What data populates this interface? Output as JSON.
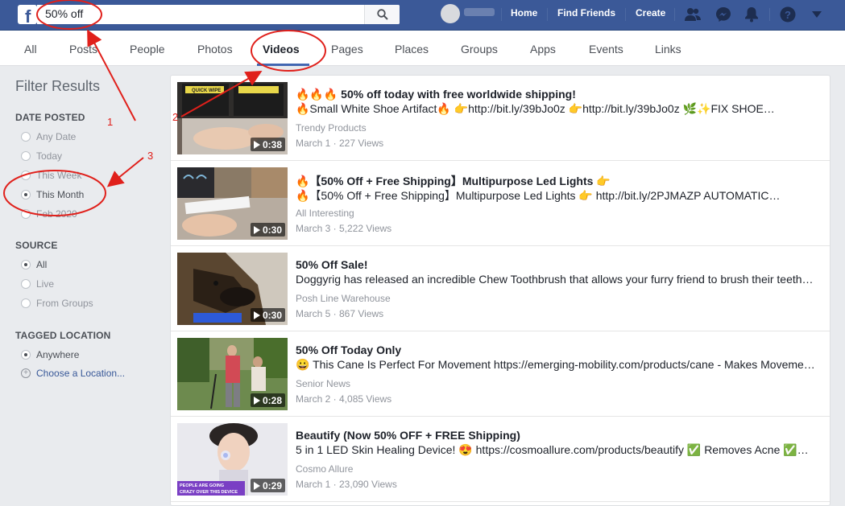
{
  "header": {
    "logo": "f",
    "search_value": "50% off",
    "nav": [
      "Home",
      "Find Friends",
      "Create"
    ]
  },
  "tabs": [
    "All",
    "Posts",
    "People",
    "Photos",
    "Videos",
    "Pages",
    "Places",
    "Groups",
    "Apps",
    "Events",
    "Links"
  ],
  "sidebar": {
    "title": "Filter Results",
    "date_posted": {
      "heading": "DATE POSTED",
      "options": [
        "Any Date",
        "Today",
        "This Week",
        "This Month",
        "Feb 2020"
      ],
      "selected": "This Month"
    },
    "source": {
      "heading": "SOURCE",
      "options": [
        "All",
        "Live",
        "From Groups"
      ],
      "selected": "All"
    },
    "tagged_location": {
      "heading": "TAGGED LOCATION",
      "options": [
        "Anywhere"
      ],
      "selected": "Anywhere",
      "choose": "Choose a Location..."
    }
  },
  "results": [
    {
      "title": "🔥🔥🔥 50% off today with free worldwide shipping!",
      "desc": "🔥Small White Shoe Artifact🔥 👉http://bit.ly/39bJo0z 👉http://bit.ly/39bJo0z 🌿✨FIX SHOE…",
      "page": "Trendy Products",
      "meta": "March 1 · 227 Views",
      "duration": "0:38",
      "thumb_text": "QUICK WIPE"
    },
    {
      "title": "🔥【50% Off + Free Shipping】Multipurpose Led Lights 👉",
      "desc": "🔥【50% Off + Free Shipping】Multipurpose Led Lights 👉 http://bit.ly/2PJMAZP AUTOMATIC…",
      "page": "All Interesting",
      "meta": "March 3 · 5,222 Views",
      "duration": "0:30",
      "thumb_text": ""
    },
    {
      "title": "50% Off Sale!",
      "desc": "Doggyrig has released an incredible Chew Toothbrush that allows your furry friend to brush their teeth…",
      "page": "Posh Line Warehouse",
      "meta": "March 5 · 867 Views",
      "duration": "0:30",
      "thumb_text": ""
    },
    {
      "title": "50% Off Today Only",
      "desc": "😀 This Cane Is Perfect For Movement https://emerging-mobility.com/products/cane - Makes Moveme…",
      "page": "Senior News",
      "meta": "March 2 · 4,085 Views",
      "duration": "0:28",
      "thumb_text": ""
    },
    {
      "title": "Beautify (Now 50% OFF + FREE Shipping)",
      "desc": "5 in 1 LED Skin Healing Device! 😍 https://cosmoallure.com/products/beautify ✅ Removes Acne ✅…",
      "page": "Cosmo Allure",
      "meta": "March 1 · 23,090 Views",
      "duration": "0:29",
      "thumb_text": "PEOPLE ARE GOING CRAZY OVER THIS DEVICE"
    }
  ],
  "annotations": [
    "1",
    "2",
    "3"
  ],
  "colors": {
    "brand": "#3b5998",
    "annotation": "#e0201b",
    "link": "#385898"
  }
}
